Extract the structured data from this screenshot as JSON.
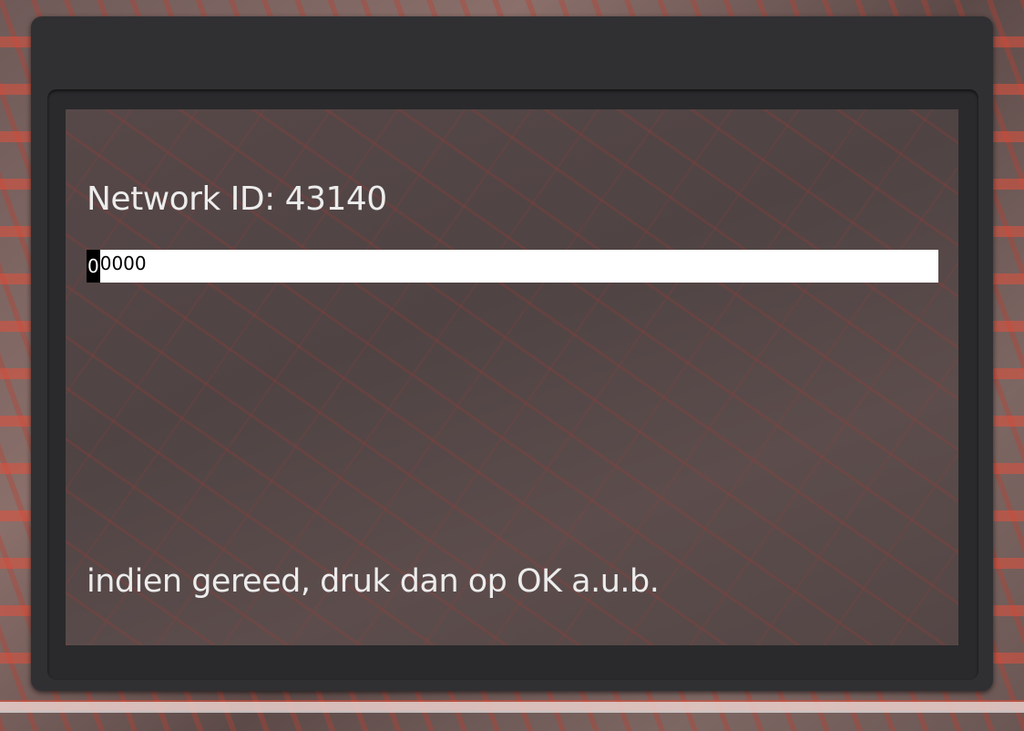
{
  "dialog": {
    "network_id_label": "Network ID: 43140",
    "input": {
      "cursor_char": "0",
      "rest_value": "0000"
    },
    "hint": "indien gereed, druk dan op OK a.u.b."
  },
  "colors": {
    "dialog_bg": "#303033",
    "text": "#ececec",
    "input_bg": "#ffffff"
  }
}
